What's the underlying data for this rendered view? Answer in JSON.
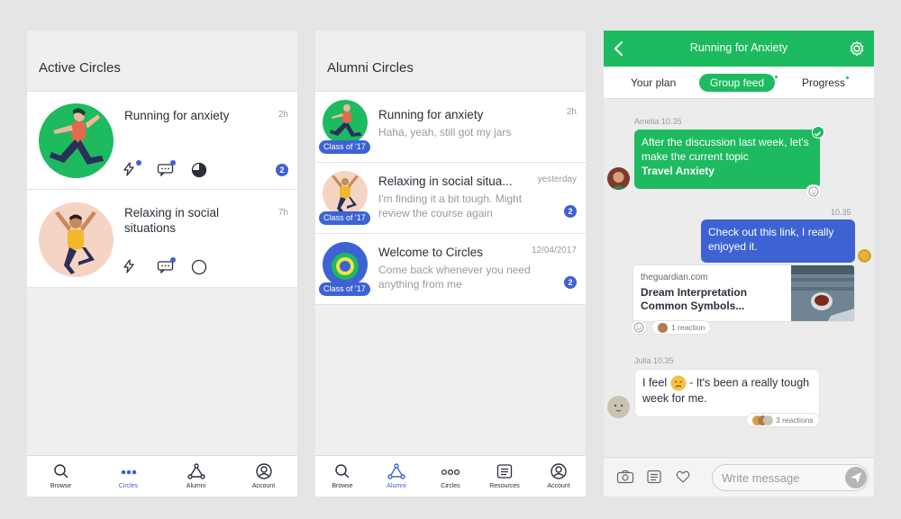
{
  "colors": {
    "green": "#1dba5f",
    "blue": "#3d63d3",
    "text": "#2a2f3a",
    "muted": "#9a9a9a"
  },
  "active_circles": {
    "title": "Active Circles",
    "items": [
      {
        "title": "Running for anxiety",
        "time": "2h",
        "count": "2",
        "icons": [
          "bolt-icon",
          "chat-icon",
          "progress-pie-icon"
        ]
      },
      {
        "title": "Relaxing in social situations",
        "time": "7h",
        "icons": [
          "bolt-icon",
          "chat-icon",
          "empty-circle-icon"
        ]
      }
    ],
    "tabs": [
      {
        "label": "Browse",
        "icon": "search-icon",
        "active": false
      },
      {
        "label": "Circles",
        "icon": "dots-icon",
        "active": true
      },
      {
        "label": "Alumni",
        "icon": "network-icon",
        "active": false
      },
      {
        "label": "Account",
        "icon": "user-icon",
        "active": false
      }
    ]
  },
  "alumni_circles": {
    "title": "Alumni Circles",
    "items": [
      {
        "title": "Running for anxiety",
        "time": "2h",
        "message": "Haha, yeah, still got my jars",
        "badge": "Class of '17"
      },
      {
        "title": "Relaxing in social situa...",
        "time": "yesterday",
        "message": "I'm finding it a bit tough. Might review the course again",
        "badge": "Class of '17",
        "count": "2"
      },
      {
        "title": "Welcome to Circles",
        "time": "12/04/2017",
        "message": "Come back whenever you need anything from me",
        "badge": "Class of '17",
        "count": "2"
      }
    ],
    "tabs": [
      {
        "label": "Browse",
        "icon": "search-icon",
        "active": false
      },
      {
        "label": "Alumni",
        "icon": "network-icon",
        "active": true
      },
      {
        "label": "Circles",
        "icon": "dots-icon",
        "active": false
      },
      {
        "label": "Resources",
        "icon": "list-icon",
        "active": false
      },
      {
        "label": "Account",
        "icon": "user-icon",
        "active": false
      }
    ]
  },
  "chat": {
    "title": "Running for Anxiety",
    "tabs": [
      "Your plan",
      "Group feed",
      "Progress"
    ],
    "active_tab": "Group feed",
    "messages": {
      "amelia_meta": "Amelia  10.35",
      "amelia_text": "After the discussion last week, let's make the current topic",
      "amelia_bold": "Travel Anxiety",
      "me_time": "10.35",
      "me_text": "Check out this link, I really enjoyed it.",
      "link_domain": "theguardian.com",
      "link_title": "Dream Interpretation Common Symbols...",
      "link_reactions": "1 reaction",
      "julia_meta": "Julia  10.35",
      "julia_text_a": "I feel",
      "julia_text_b": "- It's been a really tough week for me.",
      "julia_reactions": "3 reactions"
    },
    "composer_placeholder": "Write message"
  }
}
